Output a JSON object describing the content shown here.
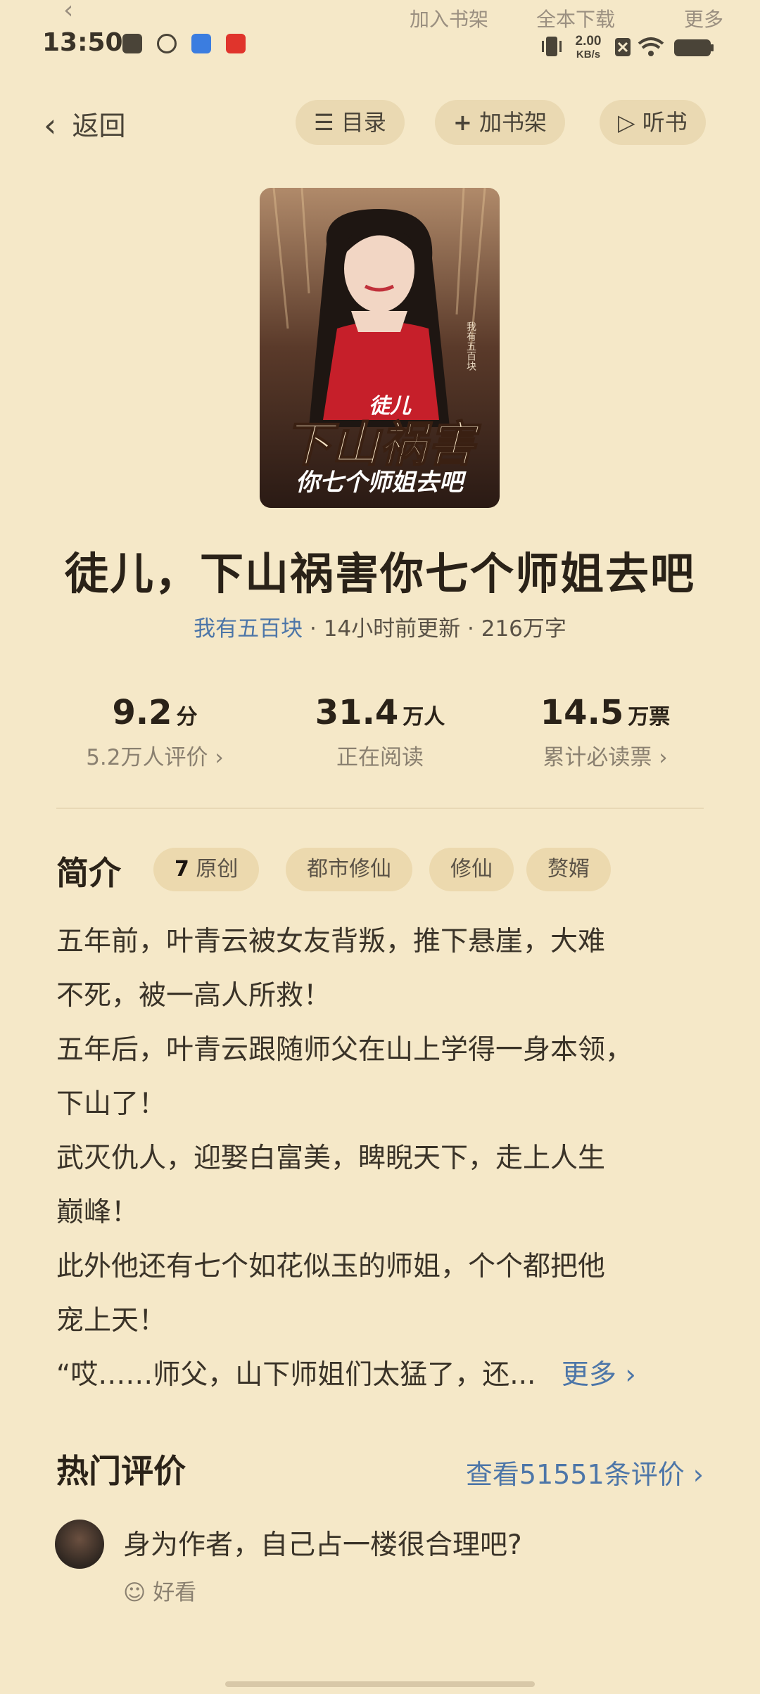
{
  "ghost_bar": {
    "add_shelf": "加入书架",
    "download": "全本下载",
    "more": "更多"
  },
  "status_bar": {
    "time": "13:50",
    "net_speed_value": "2.00",
    "net_speed_unit": "KB/s"
  },
  "nav": {
    "back": "返回",
    "catalog": "目录",
    "add_to_shelf": "加书架",
    "listen": "听书"
  },
  "book": {
    "cover_small_title": "徒儿",
    "cover_big_title": "下山祸害",
    "cover_sub_title": "你七个师姐去吧",
    "cover_author": "我有五百块",
    "title": "徒儿，下山祸害你七个师姐去吧",
    "author": "我有五百块",
    "updated": "14小时前更新",
    "word_count": "216万字"
  },
  "stats": [
    {
      "value": "9.2",
      "unit": "分",
      "label": "5.2万人评价",
      "chevron": true
    },
    {
      "value": "31.4",
      "unit": "万人",
      "label": "正在阅读",
      "chevron": false
    },
    {
      "value": "14.5",
      "unit": "万票",
      "label": "累计必读票",
      "chevron": true
    }
  ],
  "intro": {
    "heading": "简介",
    "tags": [
      "原创",
      "都市修仙",
      "修仙",
      "赘婿"
    ],
    "lines": [
      "五年前，叶青云被女友背叛，推下悬崖，大难",
      "不死，被一高人所救！",
      "五年后，叶青云跟随师父在山上学得一身本领，",
      "下山了！",
      "武灭仇人，迎娶白富美，睥睨天下，走上人生",
      "巅峰！",
      "此外他还有七个如花似玉的师姐，个个都把他",
      "宠上天！",
      "“哎……师父，山下师姐们太猛了，还..."
    ],
    "more": "更多"
  },
  "reviews": {
    "heading": "热门评价",
    "view_all": "查看51551条评价",
    "items": [
      {
        "text": "身为作者，自己占一楼很合理吧?",
        "reaction": "好看"
      }
    ]
  }
}
